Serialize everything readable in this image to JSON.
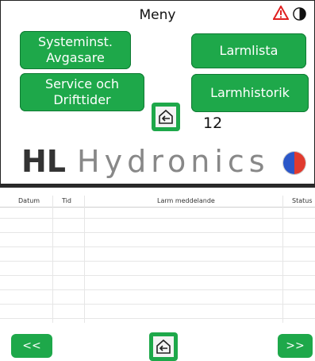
{
  "menu": {
    "title": "Meny",
    "buttons": {
      "system": "Systeminst.\nAvgasare",
      "larmlista": "Larmlista",
      "service": "Service och\nDrifttider",
      "larmhistorik": "Larmhistorik"
    },
    "count": "12",
    "brand_hl": "HL",
    "brand_word": "Hydronics"
  },
  "alarms": {
    "headers": [
      "Datum",
      "Tid",
      "Larm meddelande",
      "Status"
    ],
    "prev": "<<",
    "next": ">>"
  },
  "colors": {
    "accent": "#1ea84a",
    "warning": "#e02020"
  },
  "icons": {
    "warning": "warning-triangle-icon",
    "status": "half-circle-icon",
    "home": "home-back-icon"
  }
}
